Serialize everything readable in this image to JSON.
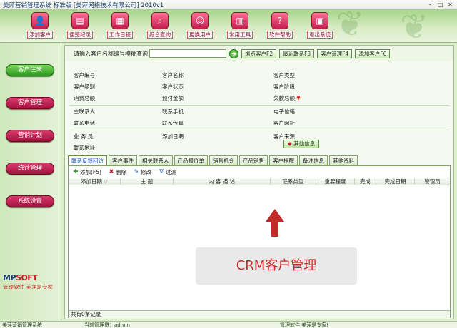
{
  "window": {
    "title": "美萍营销管理系统  标准版  [美萍网络技术有限公司]  2010v1",
    "controls": [
      "–",
      "□",
      "✕"
    ]
  },
  "toolbar": {
    "buttons": [
      {
        "label": "添加客户",
        "icon": "add-customer-icon",
        "glyph": "👤"
      },
      {
        "label": "便签纪录",
        "icon": "notes-icon",
        "glyph": "▤"
      },
      {
        "label": "工作日程",
        "icon": "calendar-icon",
        "glyph": "▦"
      },
      {
        "label": "综合查询",
        "icon": "search-icon",
        "glyph": "⌕"
      },
      {
        "label": "更换用户",
        "icon": "switch-user-icon",
        "glyph": "☺"
      },
      {
        "label": "常用工具",
        "icon": "tools-icon",
        "glyph": "▥"
      },
      {
        "label": "软件帮助",
        "icon": "help-icon",
        "glyph": "?"
      },
      {
        "label": "退出系统",
        "icon": "exit-icon",
        "glyph": "▣"
      }
    ]
  },
  "sidebar": {
    "items": [
      {
        "label": "客户往来",
        "active": true
      },
      {
        "label": "客户管理",
        "active": false
      },
      {
        "label": "营销计划",
        "active": false
      },
      {
        "label": "统计管理",
        "active": false
      },
      {
        "label": "系统设置",
        "active": false
      }
    ],
    "logo": {
      "mark_prefix": "MP",
      "mark_suffix": "SOFT",
      "slogan": "管理软件  美萍是专家"
    }
  },
  "search": {
    "label": "请输入客户名称编号模糊查询",
    "value": "",
    "go": "➜",
    "buttons": [
      "浏览客户F2",
      "最近联系F3",
      "客户管理F4",
      "添加客户F6"
    ]
  },
  "customer_info": {
    "fields": [
      [
        "客户编号",
        "客户名称",
        "客户类型"
      ],
      [
        "客户级别",
        "客户状态",
        "客户阶段"
      ],
      [
        "消费总额",
        "预付金额",
        "欠款总额"
      ],
      [
        "主联系人",
        "联系手机",
        "电子信箱"
      ],
      [
        "联系电话",
        "联系传真",
        "客户网址"
      ],
      [
        "业 务 员",
        "添加日期",
        "客户来源"
      ],
      [
        "联系地址",
        "",
        ""
      ]
    ],
    "arrears_mark": "¥",
    "more_button": "其他信息"
  },
  "tabs": [
    "联系反馈回访",
    "客户事件",
    "相关联系人",
    "产品报价单",
    "销售机会",
    "产品销售",
    "客户提醒",
    "备注信息",
    "其他资料"
  ],
  "actions": [
    {
      "label": "添加(F5)",
      "icon": "add-icon",
      "glyph": "✚"
    },
    {
      "label": "删除",
      "icon": "delete-icon",
      "glyph": "✖"
    },
    {
      "label": "修改",
      "icon": "edit-icon",
      "glyph": "✎"
    },
    {
      "label": "过滤",
      "icon": "filter-icon",
      "glyph": "⛛"
    }
  ],
  "table": {
    "columns": [
      "添加日期",
      "主  题",
      "内  容  描  述",
      "联系类型",
      "重要程度",
      "完成",
      "完成日期",
      "管理员"
    ],
    "sort_mark": "▽",
    "record_count": "共有0条记录"
  },
  "overlay": {
    "text": "CRM客户管理"
  },
  "status": {
    "app": "美萍营销管理系统",
    "user": "当前管理员：admin",
    "slogan": "管理软件 美萍是专家!"
  },
  "colors": {
    "nav_button": "#b51a4a",
    "nav_active": "#3aa227",
    "toolbar_icon": "#d8335f",
    "overlay_text": "#c72c2c"
  }
}
